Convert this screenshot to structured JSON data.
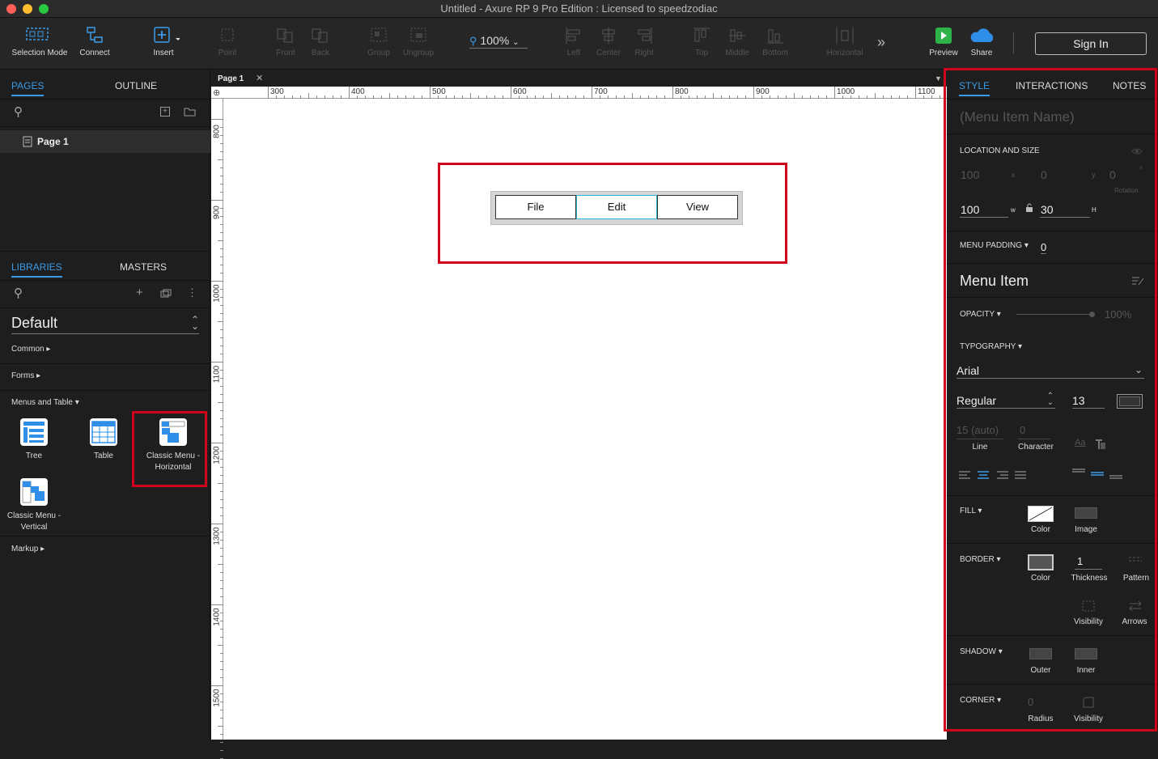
{
  "window": {
    "title": "Untitled - Axure RP 9 Pro Edition : Licensed to speedzodiac"
  },
  "toolbar": {
    "selection_mode": "Selection Mode",
    "connect": "Connect",
    "insert": "Insert",
    "point": "Point",
    "front": "Front",
    "back": "Back",
    "group": "Group",
    "ungroup": "Ungroup",
    "zoom": "100%",
    "left": "Left",
    "center": "Center",
    "right": "Right",
    "top": "Top",
    "middle": "Middle",
    "bottom": "Bottom",
    "horizontal": "Horizontal",
    "more": "»",
    "preview": "Preview",
    "share": "Share",
    "sign_in": "Sign In"
  },
  "pages_panel": {
    "tabs": [
      "PAGES",
      "OUTLINE"
    ],
    "pages": [
      {
        "label": "Page 1"
      }
    ]
  },
  "libraries_panel": {
    "tabs": [
      "LIBRARIES",
      "MASTERS"
    ],
    "library": "Default",
    "sections": {
      "common": "Common ▸",
      "forms": "Forms ▸",
      "menus": "Menus and Table ▾",
      "markup": "Markup ▸"
    },
    "widgets": [
      {
        "label": "Tree",
        "icon": "tree-icon"
      },
      {
        "label": "Table",
        "icon": "table-icon"
      },
      {
        "label": "Classic Menu - Horizontal",
        "icon": "menu-horizontal-icon"
      },
      {
        "label": "Classic Menu - Vertical",
        "icon": "menu-vertical-icon"
      }
    ]
  },
  "canvas": {
    "tab": "Page 1",
    "h_ruler": [
      "300",
      "400",
      "500",
      "600",
      "700",
      "800",
      "900",
      "1000",
      "1100"
    ],
    "v_ruler": [
      "800",
      "900",
      "1000",
      "1100",
      "1200",
      "1300",
      "1400",
      "1500"
    ],
    "menu_items": [
      "File",
      "Edit",
      "View"
    ]
  },
  "inspector": {
    "tabs": [
      "STYLE",
      "INTERACTIONS",
      "NOTES"
    ],
    "name_placeholder": "(Menu Item Name)",
    "location_size": {
      "title": "LOCATION AND SIZE",
      "x": "100",
      "x_label": "x",
      "y": "0",
      "y_label": "y",
      "rotation": "0",
      "rotation_unit": "°",
      "rotation_label": "Rotation",
      "w": "100",
      "w_label": "w",
      "h": "30",
      "h_label": "H"
    },
    "menu_padding": {
      "label": "MENU PADDING ▾",
      "value": "0"
    },
    "style_name": "Menu Item",
    "opacity": {
      "label": "OPACITY ▾",
      "value": "100%",
      "level": 1.0
    },
    "typography": {
      "label": "TYPOGRAPHY ▾",
      "font": "Arial",
      "weight": "Regular",
      "size": "13",
      "line": "15 (auto)",
      "line_label": "Line",
      "character": "0",
      "character_label": "Character"
    },
    "fill": {
      "label": "FILL ▾",
      "color": "Color",
      "image": "Image"
    },
    "border": {
      "label": "BORDER ▾",
      "color": "Color",
      "thickness": "1",
      "thickness_label": "Thickness",
      "pattern": "Pattern",
      "visibility": "Visibility",
      "arrows": "Arrows"
    },
    "shadow": {
      "label": "SHADOW ▾",
      "outer": "Outer",
      "inner": "Inner"
    },
    "corner": {
      "label": "CORNER ▾",
      "radius": "0",
      "radius_label": "Radius",
      "visibility": "Visibility"
    }
  },
  "colors": {
    "accent": "#3a9be8",
    "highlight": "#d0021b",
    "preview": "#2db34a",
    "share": "#2e8ee8"
  }
}
